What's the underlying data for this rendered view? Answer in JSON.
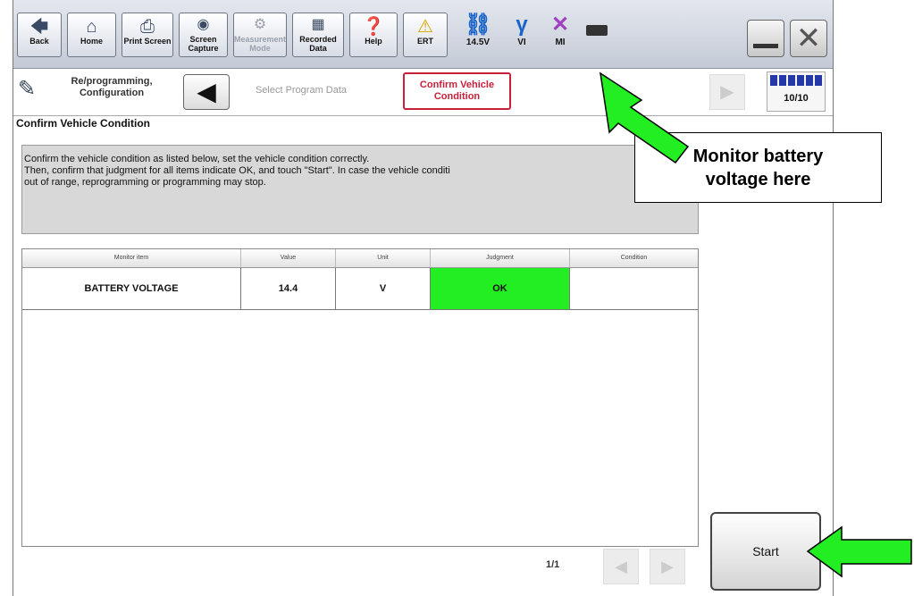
{
  "toolbar": {
    "buttons": [
      {
        "label": "Back",
        "icon": "back-arrow-icon"
      },
      {
        "label": "Home",
        "icon": "home-icon"
      },
      {
        "label": "Print Screen",
        "icon": "printer-icon"
      },
      {
        "label": "Screen Capture",
        "icon": "camera-icon"
      },
      {
        "label": "Measurement Mode",
        "icon": "measurement-icon"
      },
      {
        "label": "Recorded Data",
        "icon": "recorded-data-icon"
      },
      {
        "label": "Help",
        "icon": "help-icon"
      },
      {
        "label": "ERT",
        "icon": "warning-icon"
      }
    ],
    "status": {
      "battery_voltage": "14.5V",
      "vi_label": "VI",
      "mi_label": "MI"
    }
  },
  "breadcrumb": {
    "section": "Re/programming, Configuration",
    "previous_step": "Select Program Data",
    "current_step": "Confirm Vehicle Condition",
    "progress": "10/10"
  },
  "main": {
    "title": "Confirm Vehicle Condition",
    "message_lines": [
      "Confirm the vehicle condition as listed below, set the vehicle condition correctly.",
      "Then, confirm that judgment for all items indicate OK, and touch \"Start\". In case the vehicle conditi",
      "out of range, reprogramming or programming may stop."
    ],
    "table": {
      "columns": [
        "Monitor item",
        "Value",
        "Unit",
        "Judgment",
        "Condition"
      ],
      "rows": [
        {
          "monitor_item": "BATTERY VOLTAGE",
          "value": "14.4",
          "unit": "V",
          "judgment": "OK",
          "condition": ""
        }
      ]
    },
    "pager": "1/1",
    "start_label": "Start"
  },
  "annotation": {
    "callout_text_line1": "Monitor battery",
    "callout_text_line2": "voltage here"
  },
  "colors": {
    "ok": "#22ee22",
    "current_step_border": "#c8203b",
    "arrow": "#22ee22"
  }
}
